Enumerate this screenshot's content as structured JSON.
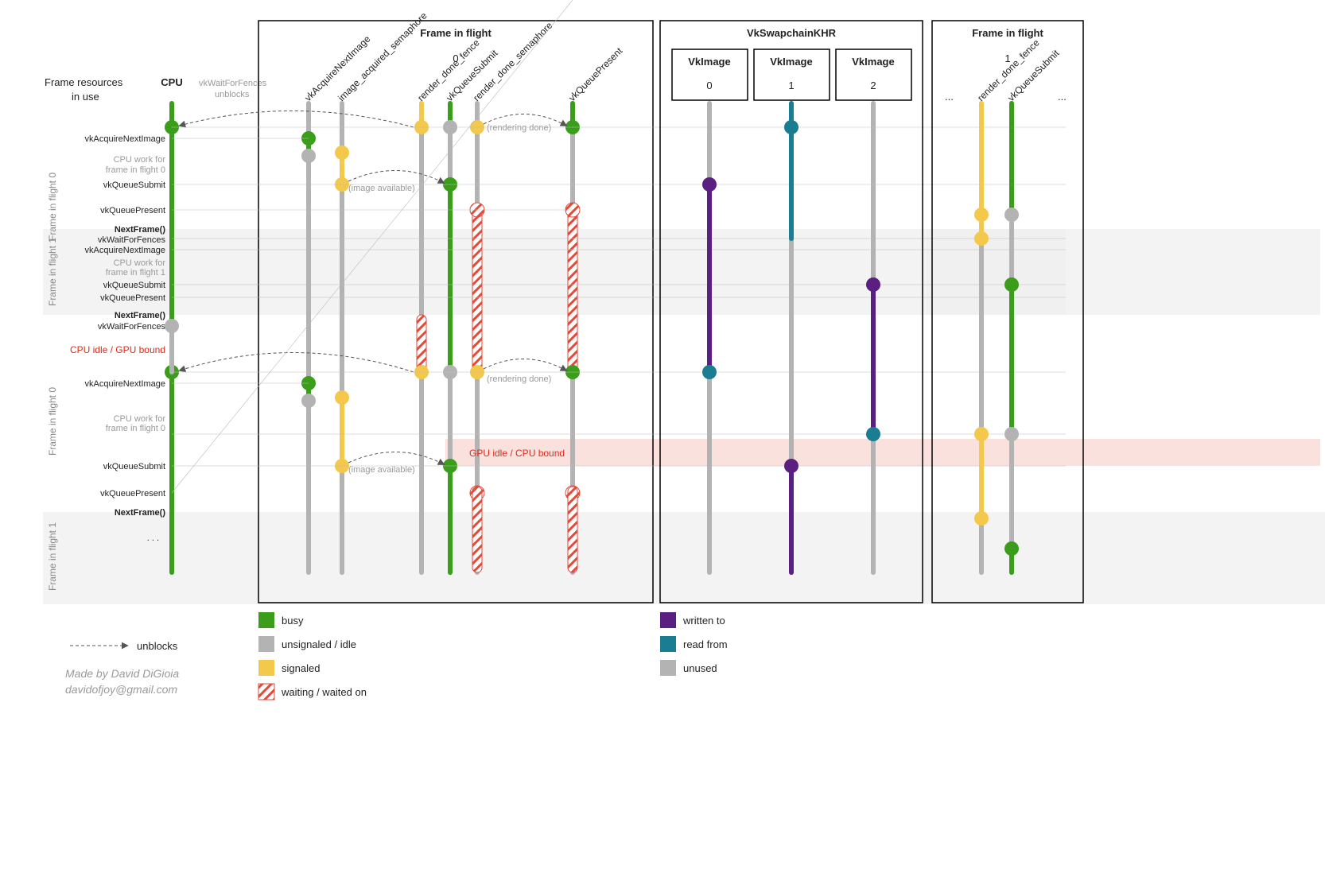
{
  "headerLeft1": "Frame resources",
  "headerLeft2": "in use",
  "cpuHeader": "CPU",
  "annot_waitUnblocks1": "vkWaitForFences",
  "annot_waitUnblocks2": "unblocks",
  "boxes": {
    "fif": {
      "title": "Frame in flight",
      "num": "0"
    },
    "swap": {
      "title": "VkSwapchainKHR",
      "img": "VkImage",
      "n0": "0",
      "n1": "1",
      "n2": "2"
    },
    "fif1": {
      "title": "Frame in flight",
      "num": "1",
      "dotsL": "...",
      "dotsR": "..."
    }
  },
  "lanes": {
    "acq": "vkAcquireNextImage",
    "imgSem": "image_acquired_semaphore",
    "fence": "render_done_fence",
    "submit": "vkQueueSubmit",
    "rdSem": "render_done_semaphore",
    "present": "vkQueuePresent",
    "fence1": "render_done_fence",
    "submit1": "vkQueueSubmit"
  },
  "sideLabels": {
    "fif0": "Frame in flight 0",
    "fif1": "Frame in flight 1"
  },
  "rows": {
    "acq": "vkAcquireNextImage",
    "cpu1": "CPU work for",
    "cpu2": "frame in flight 0",
    "cpu1b": "CPU work for",
    "cpu2b": "frame in flight 1",
    "submit": "vkQueueSubmit",
    "present": "vkQueuePresent",
    "next": "NextFrame()",
    "wait": "vkWaitForFences",
    "dots": ". . ."
  },
  "annotRender": "(rendering done)",
  "annotImage": "(image available)",
  "cpuIdle": "CPU idle / GPU bound",
  "gpuIdle": "GPU idle / CPU bound",
  "legend": {
    "busy": "busy",
    "idle": "unsignaled / idle",
    "signaled": "signaled",
    "waiting": "waiting / waited on",
    "written": "written to",
    "read": "read from",
    "unused": "unused",
    "unblocks": "unblocks"
  },
  "credit1": "Made by David DiGioia",
  "credit2": "davidofjoy@gmail.com"
}
